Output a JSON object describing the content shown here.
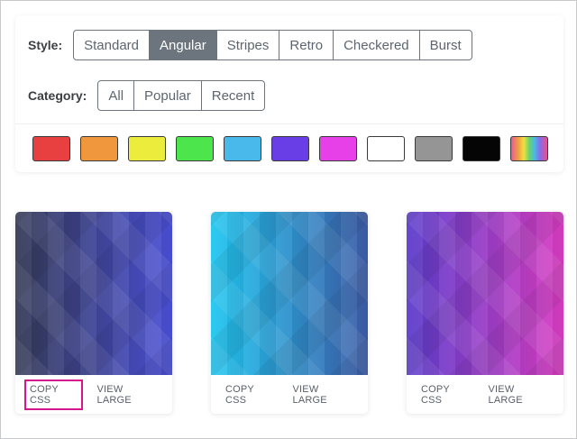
{
  "filters": {
    "style": {
      "label": "Style:",
      "options": [
        "Standard",
        "Angular",
        "Stripes",
        "Retro",
        "Checkered",
        "Burst"
      ],
      "active": "Angular"
    },
    "category": {
      "label": "Category:",
      "options": [
        "All",
        "Popular",
        "Recent"
      ],
      "active": null
    },
    "colors": [
      {
        "name": "red",
        "hex": "#e84040"
      },
      {
        "name": "orange",
        "hex": "#f0963c"
      },
      {
        "name": "yellow",
        "hex": "#ecec3c"
      },
      {
        "name": "green",
        "hex": "#4ce64c"
      },
      {
        "name": "blue",
        "hex": "#49b8ea"
      },
      {
        "name": "purple",
        "hex": "#6a3ee6"
      },
      {
        "name": "magenta",
        "hex": "#e840e8"
      },
      {
        "name": "white",
        "hex": "#ffffff"
      },
      {
        "name": "gray",
        "hex": "#959595"
      },
      {
        "name": "black",
        "hex": "#050505"
      },
      {
        "name": "rainbow",
        "hex": "rainbow"
      }
    ]
  },
  "cards": [
    {
      "copy_label": "COPY CSS",
      "view_label": "VIEW LARGE",
      "colors": [
        "#353b58",
        "#4a4fd6"
      ],
      "copy_highlighted": true
    },
    {
      "copy_label": "COPY CSS",
      "view_label": "VIEW LARGE",
      "colors": [
        "#1fc6f0",
        "#3d5ca8"
      ],
      "copy_highlighted": false
    },
    {
      "copy_label": "COPY CSS",
      "view_label": "VIEW LARGE",
      "colors": [
        "#5b3ccb",
        "#d83cc2"
      ],
      "copy_highlighted": false
    }
  ],
  "accent": "#d6168a"
}
